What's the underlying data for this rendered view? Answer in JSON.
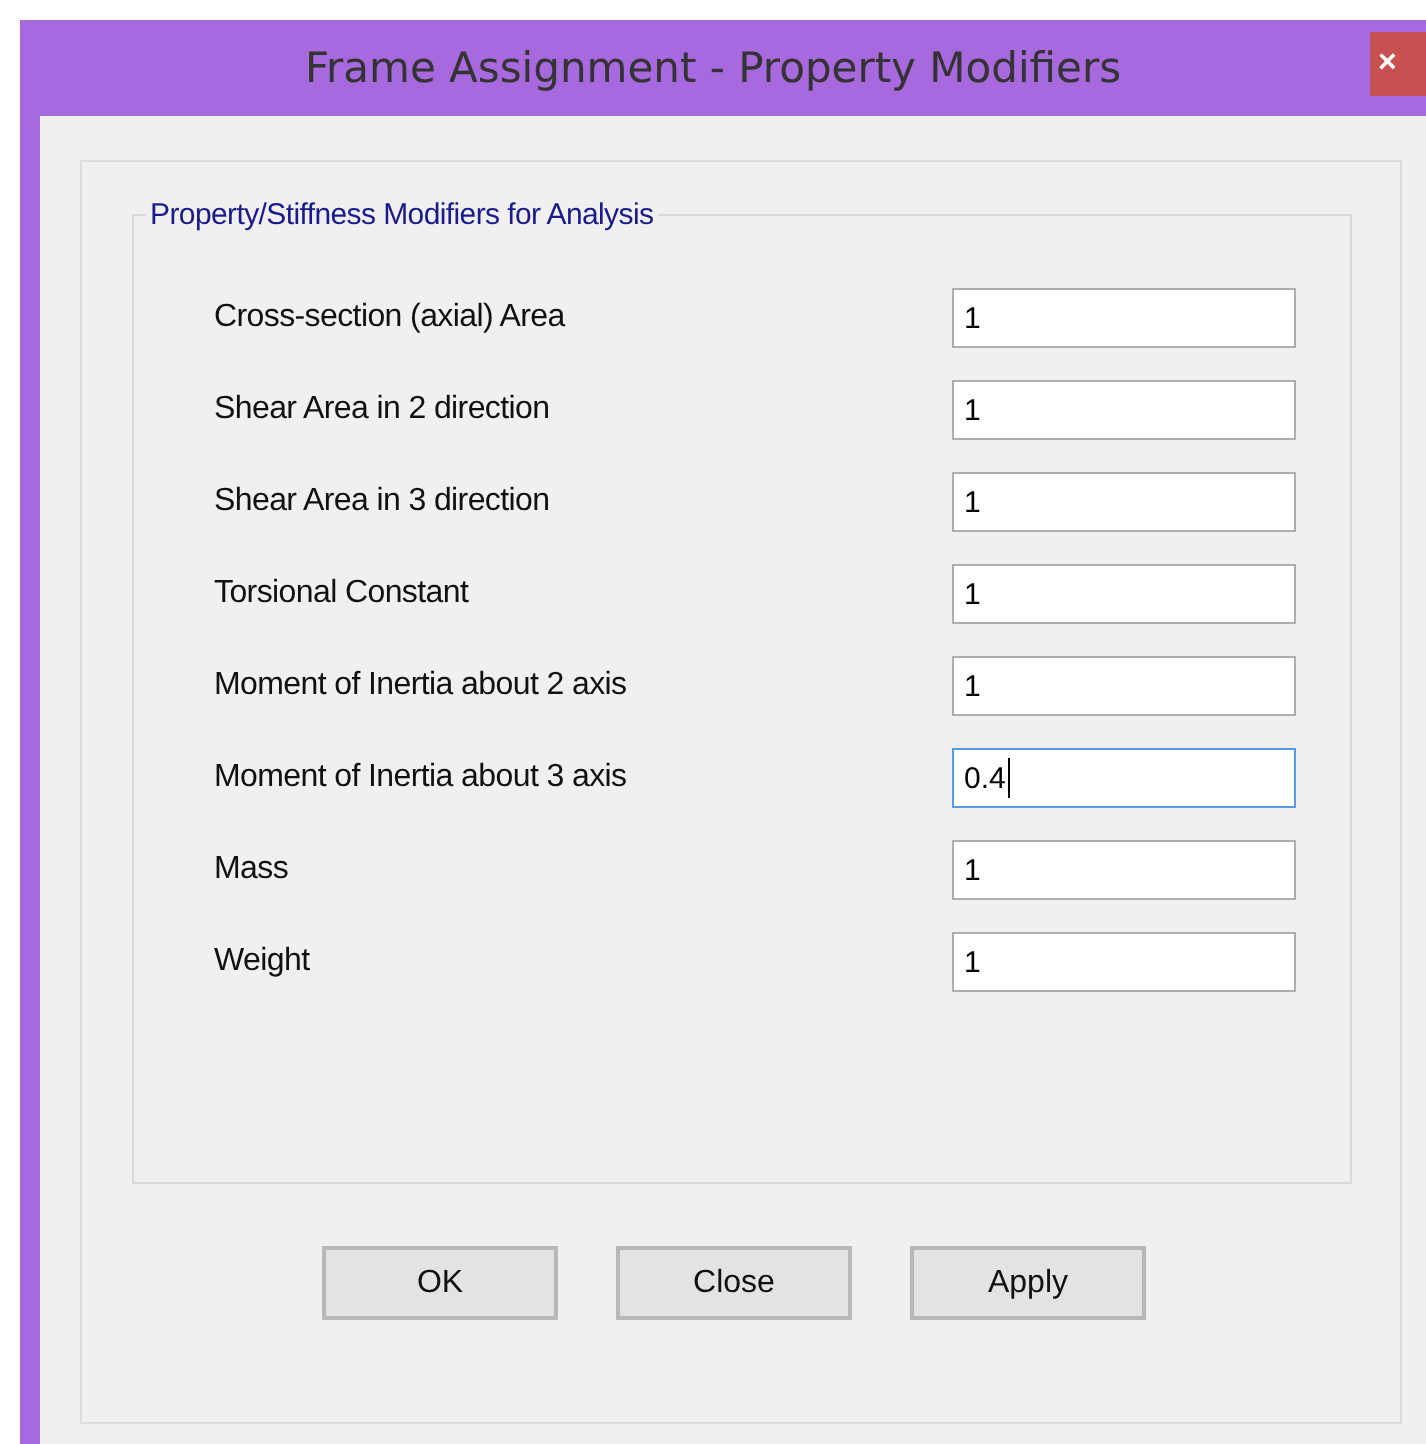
{
  "window": {
    "title": "Frame Assignment - Property Modifiers",
    "close": "×"
  },
  "group": {
    "title": "Property/Stiffness Modifiers for Analysis",
    "rows": [
      {
        "label": "Cross-section (axial) Area",
        "value": "1",
        "focused": false
      },
      {
        "label": "Shear Area in 2 direction",
        "value": "1",
        "focused": false
      },
      {
        "label": "Shear Area in 3 direction",
        "value": "1",
        "focused": false
      },
      {
        "label": "Torsional Constant",
        "value": "1",
        "focused": false
      },
      {
        "label": "Moment of Inertia about 2 axis",
        "value": "1",
        "focused": false
      },
      {
        "label": "Moment of Inertia about 3 axis",
        "value": "0.4",
        "focused": true
      },
      {
        "label": "Mass",
        "value": "1",
        "focused": false
      },
      {
        "label": "Weight",
        "value": "1",
        "focused": false
      }
    ]
  },
  "buttons": [
    "OK",
    "Close",
    "Apply"
  ]
}
